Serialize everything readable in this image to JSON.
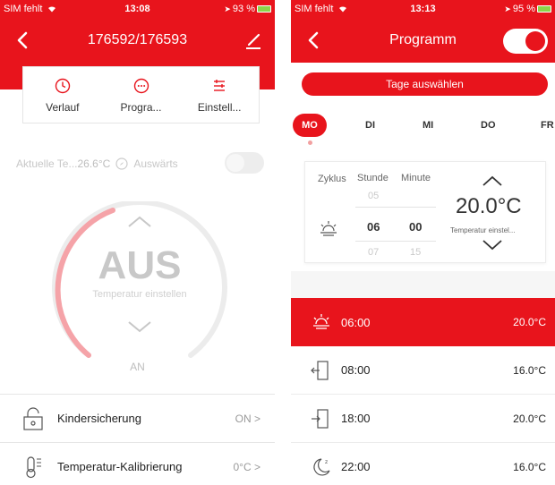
{
  "phone1": {
    "status": {
      "carrier": "SIM fehlt",
      "time": "13:08",
      "battery": "93 %"
    },
    "header": {
      "title": "176592/176593"
    },
    "tabs": [
      {
        "label": "Verlauf",
        "icon": "clock-icon"
      },
      {
        "label": "Progra...",
        "icon": "dots-icon"
      },
      {
        "label": "Einstell...",
        "icon": "sliders-icon"
      }
    ],
    "current_temp": {
      "label": "Aktuelle Te...",
      "value": "26.6°C",
      "away_label": "Auswärts"
    },
    "dial": {
      "state": "AUS",
      "sub": "Temperatur einstellen"
    },
    "an_label": "AN",
    "settings": [
      {
        "label": "Kindersicherung",
        "value": "ON",
        "icon": "lock-icon"
      },
      {
        "label": "Temperatur-Kalibrierung",
        "value": "0°C",
        "icon": "thermometer-icon"
      }
    ],
    "colors": {
      "accent": "#e8141c"
    }
  },
  "phone2": {
    "status": {
      "carrier": "SIM fehlt",
      "time": "13:13",
      "battery": "95 %"
    },
    "header": {
      "title": "Programm"
    },
    "select_days": "Tage auswählen",
    "days": [
      "MO",
      "DI",
      "MI",
      "DO",
      "FR"
    ],
    "selected_day": "MO",
    "editor": {
      "col_cycle": "Zyklus",
      "col_hour": "Stunde",
      "col_minute": "Minute",
      "hour_prev": "05",
      "hour": "06",
      "hour_next": "07",
      "minute": "00",
      "minute_next": "15",
      "temperature": "20.0°C",
      "temp_sub": "Temperatur einstel..."
    },
    "schedule": [
      {
        "time": "06:00",
        "temp": "20.0°C",
        "icon": "sunrise-icon",
        "active": true
      },
      {
        "time": "08:00",
        "temp": "16.0°C",
        "icon": "door-exit-icon",
        "active": false
      },
      {
        "time": "18:00",
        "temp": "20.0°C",
        "icon": "door-enter-icon",
        "active": false
      },
      {
        "time": "22:00",
        "temp": "16.0°C",
        "icon": "moon-icon",
        "active": false
      }
    ]
  }
}
